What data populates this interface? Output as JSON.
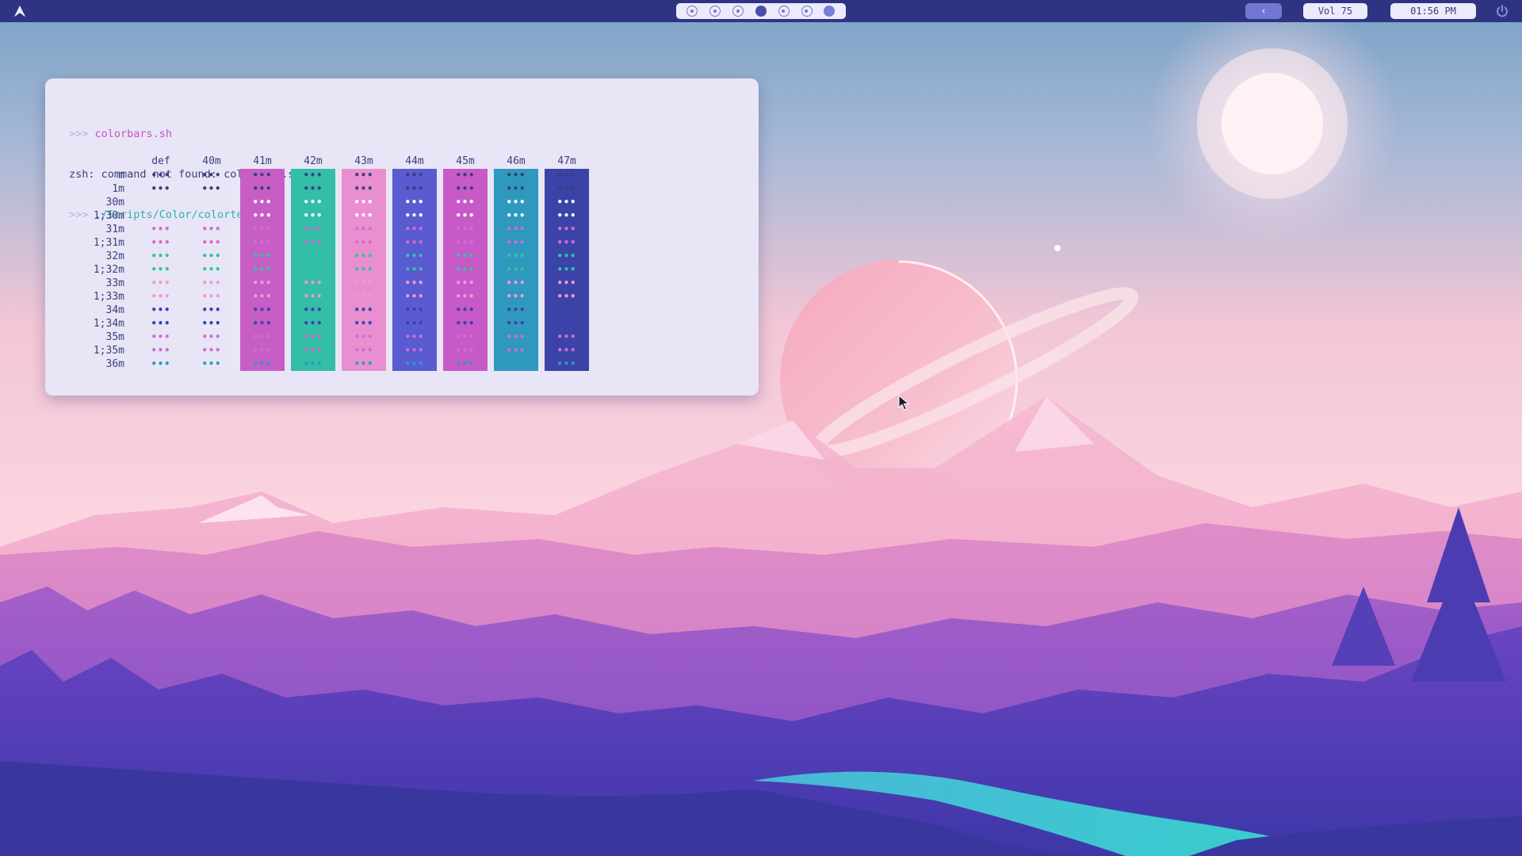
{
  "topbar": {
    "workspaces": [
      {
        "state": "empty"
      },
      {
        "state": "empty"
      },
      {
        "state": "empty"
      },
      {
        "state": "active"
      },
      {
        "state": "empty"
      },
      {
        "state": "empty"
      },
      {
        "state": "occupied"
      }
    ],
    "back_label": "‹",
    "volume_label": "Vol 75",
    "clock_label": "01:56 PM",
    "logo_icon": "arch-logo-icon",
    "power_icon": "power-icon"
  },
  "terminal": {
    "prompt": ">>>",
    "line1_cmd": "colorbars.sh",
    "line2": "zsh: command not found: colorbars.sh",
    "line3_cmd": "./Scripts/Color/colortest.sh",
    "column_headers": [
      "def",
      "40m",
      "41m",
      "42m",
      "43m",
      "44m",
      "45m",
      "46m",
      "47m"
    ],
    "row_labels": [
      "m",
      "1m",
      "30m",
      "1;30m",
      "31m",
      "1;31m",
      "32m",
      "1;32m",
      "33m",
      "1;33m",
      "34m",
      "1;34m",
      "35m",
      "1;35m",
      "36m"
    ],
    "dots_text": "•••"
  },
  "colors": {
    "topbar_bg": "#2e3481",
    "terminal_bg": "#e8e6f6",
    "text_fg": "#3a3f7a",
    "bg_40": "none",
    "bg_41": "#c65ec6",
    "bg_42": "#33bea7",
    "bg_43": "#e98fcf",
    "bg_44": "#5a5ad1",
    "bg_45": "#c75ac6",
    "bg_46": "#2f98bd",
    "bg_47": "#3b43a8",
    "fg_30": "#ffffff",
    "fg_31": "#d56ad0",
    "fg_32": "#2fc4a6",
    "fg_33": "#ef9ad2",
    "fg_34": "#3d42b0",
    "fg_35": "#d06cd0",
    "fg_36": "#2b9cc4",
    "fg_default": "#3a3f7a"
  }
}
